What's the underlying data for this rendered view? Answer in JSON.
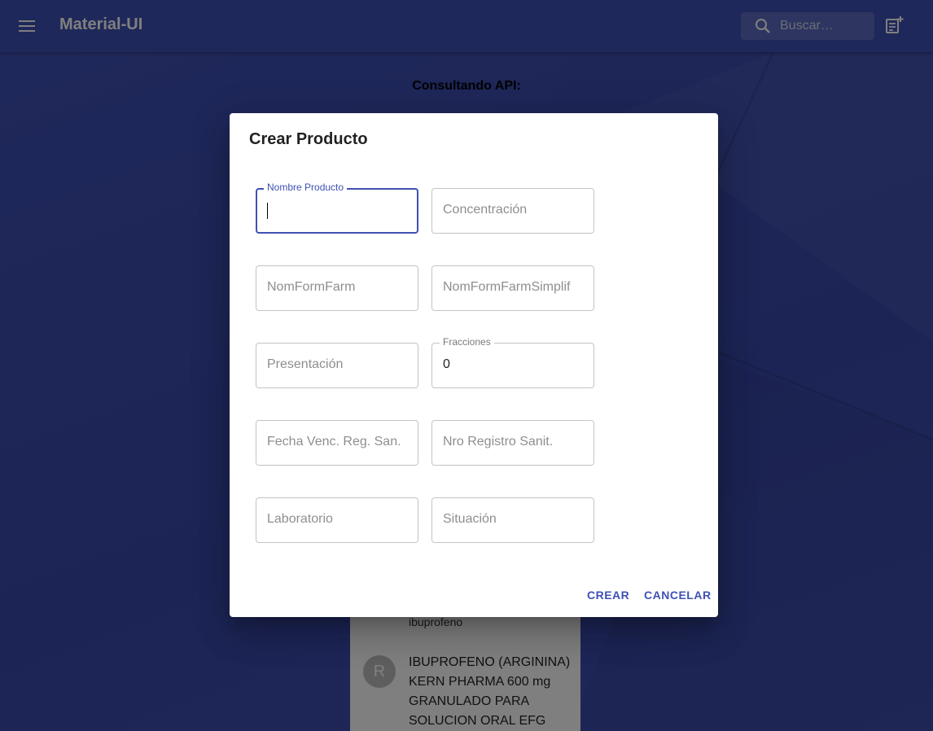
{
  "appbar": {
    "title": "Material-UI",
    "search_placeholder": "Buscar…",
    "color": "#3f51b5"
  },
  "page": {
    "heading": "Consultando API:",
    "list": {
      "subtitle": "ibuprofeno",
      "item": {
        "avatar_letter": "R",
        "lines": [
          "IBUPROFENO (ARGININA)",
          "KERN PHARMA 600 mg",
          "GRANULADO PARA",
          "SOLUCION ORAL EFG"
        ]
      }
    }
  },
  "dialog": {
    "title": "Crear Producto",
    "fields": {
      "nombre_producto": {
        "label": "Nombre Producto",
        "value": ""
      },
      "concentracion": {
        "placeholder": "Concentración"
      },
      "nom_form_farm": {
        "placeholder": "NomFormFarm"
      },
      "nom_form_farm_simplif": {
        "placeholder": "NomFormFarmSimplif"
      },
      "presentacion": {
        "placeholder": "Presentación"
      },
      "fracciones": {
        "label": "Fracciones",
        "value": "0"
      },
      "fecha_venc": {
        "placeholder": "Fecha Venc. Reg. San."
      },
      "nro_registro": {
        "placeholder": "Nro Registro Sanit."
      },
      "laboratorio": {
        "placeholder": "Laboratorio"
      },
      "situacion": {
        "placeholder": "Situación"
      }
    },
    "actions": {
      "create_label": "CREAR",
      "cancel_label": "CANCELAR"
    },
    "accent_color": "#3f51b5"
  }
}
